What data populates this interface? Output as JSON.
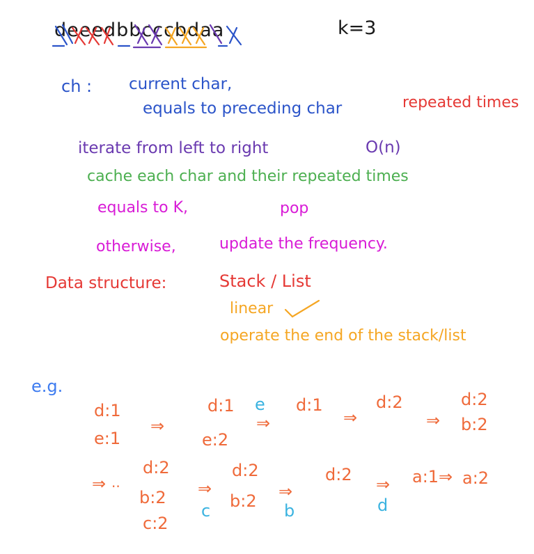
{
  "colors": {
    "black": "#1a1a1a",
    "blue": "#2b54c9",
    "purple": "#6a3ab0",
    "red": "#e53935",
    "green": "#4caf50",
    "magenta": "#d81bd6",
    "orange": "#f5a623",
    "orange_red": "#ef6a3a",
    "cyan": "#3bb3e0",
    "eg_blue": "#3e7cf0"
  },
  "header": {
    "input_string": "deeedbbcccbdaa",
    "k_label": "k=3"
  },
  "definitions": {
    "ch_label": "ch :",
    "ch_meaning": "current char,",
    "ch_condition": "equals to preceding char",
    "repeated_times": "repeated times"
  },
  "approach": {
    "iterate": "iterate from left to right",
    "complexity": "O(n)",
    "cache": "cache each char and their repeated times",
    "equals_k": "equals to K,",
    "pop": "pop",
    "otherwise": "otherwise,",
    "update": "update the frequency."
  },
  "data_structure": {
    "label": "Data structure:",
    "value": "Stack / List",
    "linear": "linear",
    "check_icon": "checkmark-icon",
    "operate": "operate the end of the stack/list"
  },
  "example": {
    "label": "e.g.",
    "arrow": "⇒",
    "steps": [
      {
        "lines": [
          "d:1",
          "e:1"
        ]
      },
      {
        "lines": [
          "d:1",
          "e:2"
        ],
        "incoming": "e"
      },
      {
        "lines": [
          "d:1"
        ]
      },
      {
        "lines": [
          "d:2"
        ]
      },
      {
        "lines": [
          "d:2",
          "b:2"
        ]
      },
      {
        "lines": [
          "d:2",
          "b:2",
          "c:2"
        ]
      },
      {
        "lines": [
          "d:2",
          "b:2"
        ],
        "incoming": "c"
      },
      {
        "lines": [
          "d:2"
        ],
        "incoming": "b"
      },
      {
        "lines": [
          "a:1"
        ],
        "incoming": "d"
      },
      {
        "lines": [
          "a:2"
        ]
      }
    ],
    "dots": ".."
  }
}
